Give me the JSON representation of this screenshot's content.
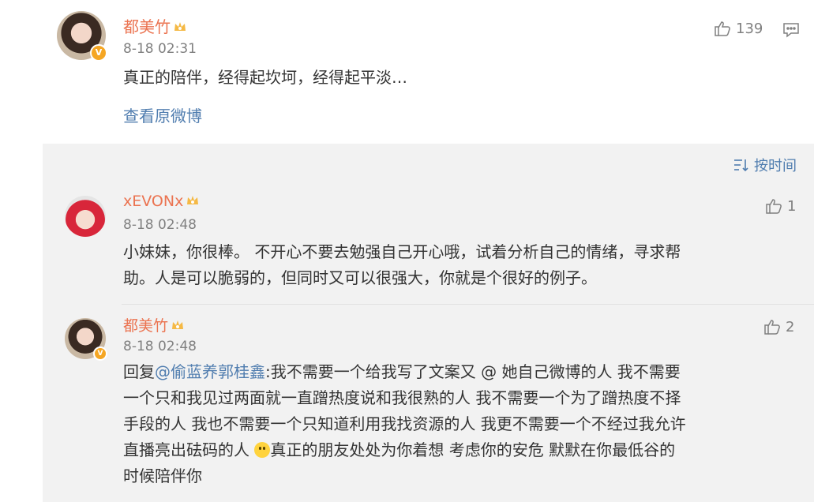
{
  "post": {
    "author": "都美竹",
    "time": "8-18 02:31",
    "text": "真正的陪伴，经得起坎坷，经得起平淡…",
    "view_original": "查看原微博",
    "like_count": "139"
  },
  "comments_header": {
    "sort_label": "按时间"
  },
  "comments": [
    {
      "author": "xEVONx",
      "time": "8-18 02:48",
      "like_count": "1",
      "text_line1": "小妹妹，你很棒。 不开心不要去勉强自己开心哦，试着分析自己的情绪，寻求帮",
      "text_line2": "助。人是可以脆弱的，但同时又可以很强大，你就是个很好的例子。"
    },
    {
      "author": "都美竹",
      "time": "8-18 02:48",
      "like_count": "2",
      "reply_prefix": "回复",
      "mention": "@偷蓝养郭桂鑫",
      "text_part1": ":我不需要一个给我写了文案又 @ 她自己微博的人 我不需要",
      "text_line2": "一个只和我见过两面就一直蹭热度说和我很熟的人 我不需要一个为了蹭热度不择",
      "text_line3": "手段的人 我也不需要一个只知道利用我找资源的人 我更不需要一个不经过我允许",
      "text_line4_pre": "直播亮出砝码的人 ",
      "text_line4_post": "真正的朋友处处为你着想 考虑你的安危 默默在你最低谷的",
      "text_line5": "时候陪伴你"
    }
  ],
  "colors": {
    "name": "#eb7350",
    "link": "#507daf",
    "muted": "#808080",
    "comment_bg": "#f2f2f2"
  },
  "icons": [
    "verified-badge-icon",
    "vip-crown-icon",
    "thumbs-up-icon",
    "comment-icon",
    "sort-icon",
    "smile-emoji-icon"
  ]
}
